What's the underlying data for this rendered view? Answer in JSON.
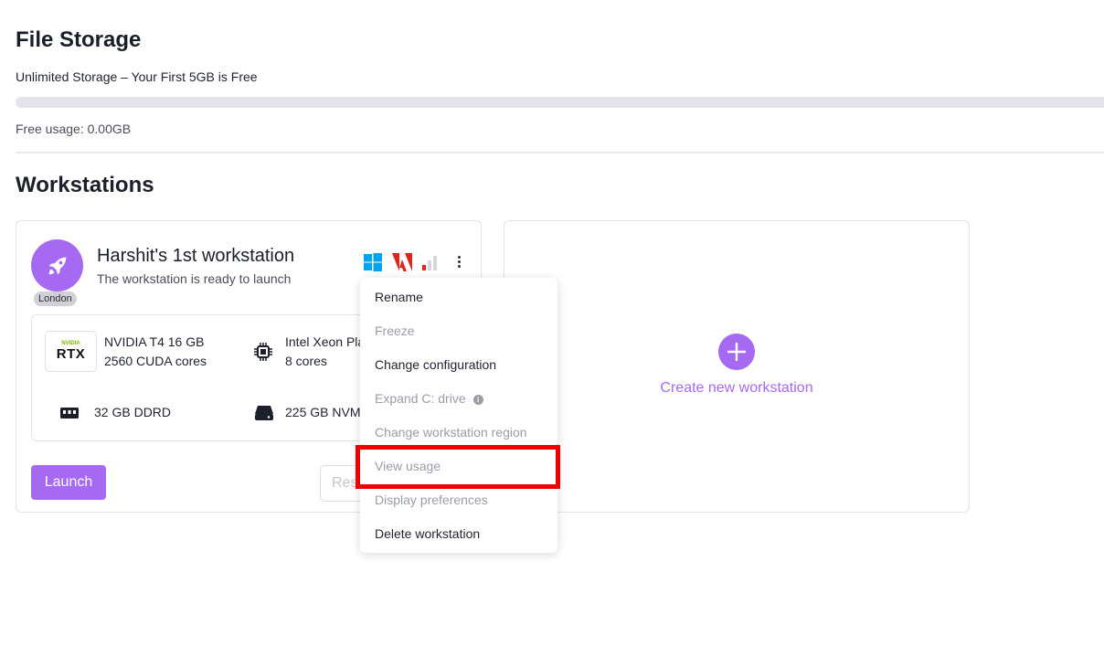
{
  "file_storage": {
    "title": "File Storage",
    "subtitle": "Unlimited Storage – Your First 5GB is Free",
    "usage_label": "Free usage:",
    "usage_value": "0.00GB",
    "usage_fraction": 0.0
  },
  "workstations": {
    "title": "Workstations",
    "card": {
      "name": "Harshit's 1st workstation",
      "status": "The workstation is ready to launch",
      "region": "London",
      "os_icons": [
        "windows-icon",
        "adobe-icon",
        "signal-strength-icon"
      ],
      "specs": {
        "gpu_name": "NVIDIA T4 16 GB",
        "gpu_cores": "2560 CUDA cores",
        "gpu_logo_brand": "NVIDIA",
        "gpu_logo_text": "RTX",
        "cpu_name": "Intel Xeon Pla",
        "cpu_cores": "8 cores",
        "ram": "32 GB DDRD",
        "storage": "225 GB NVM"
      },
      "launch_label": "Launch",
      "secondary_button_partial": "Res"
    },
    "create_label": "Create new workstation"
  },
  "context_menu": {
    "items": [
      {
        "label": "Rename",
        "enabled": true
      },
      {
        "label": "Freeze",
        "enabled": false
      },
      {
        "label": "Change configuration",
        "enabled": true
      },
      {
        "label": "Expand C: drive",
        "enabled": false
      },
      {
        "label": "Change workstation region",
        "enabled": false
      },
      {
        "label": "View usage",
        "enabled": false
      },
      {
        "label": "Display preferences",
        "enabled": false
      },
      {
        "label": "Delete workstation",
        "enabled": true
      }
    ]
  },
  "colors": {
    "accent": "#a669f2",
    "highlight": "#ee0000"
  }
}
